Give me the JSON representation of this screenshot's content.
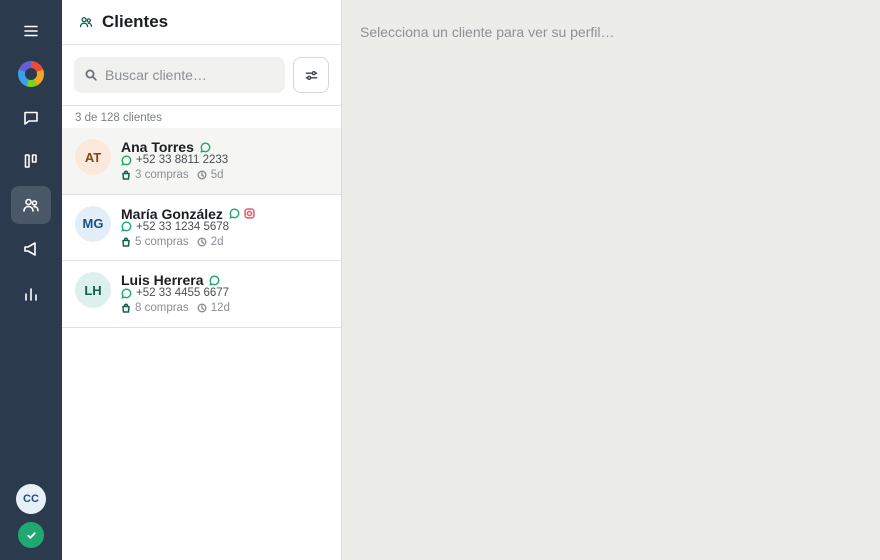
{
  "sidebar": {
    "items": [
      {
        "key": "menu",
        "icon": "menu-icon"
      },
      {
        "key": "logo",
        "icon": "logo-icon"
      },
      {
        "key": "chats",
        "icon": "chat-icon"
      },
      {
        "key": "board",
        "icon": "kanban-icon"
      },
      {
        "key": "clients",
        "icon": "users-icon",
        "active": true
      },
      {
        "key": "campaigns",
        "icon": "megaphone-icon"
      },
      {
        "key": "reports",
        "icon": "bar-chart-icon"
      }
    ],
    "user_initials": "CC",
    "status": "online"
  },
  "panel": {
    "title": "Clientes",
    "title_icon": "users-icon",
    "search_placeholder": "Buscar cliente…",
    "count_text": "3 de 128 clientes"
  },
  "clients": [
    {
      "initials": "AT",
      "name": "Ana Torres",
      "phone": "+52 33 8811 2233",
      "purchases": "3 compras",
      "last": "5d",
      "channels": [
        "whatsapp"
      ],
      "avatar_bg": "#fbeadb",
      "avatar_fg": "#7a4a1c",
      "selected": true
    },
    {
      "initials": "MG",
      "name": "María González",
      "phone": "+52 33 1234 5678",
      "purchases": "5 compras",
      "last": "2d",
      "channels": [
        "whatsapp",
        "instagram"
      ],
      "avatar_bg": "#e3eef8",
      "avatar_fg": "#1e4f86",
      "selected": false
    },
    {
      "initials": "LH",
      "name": "Luis Herrera",
      "phone": "+52 33 4455 6677",
      "purchases": "8 compras",
      "last": "12d",
      "channels": [
        "whatsapp"
      ],
      "avatar_bg": "#ddf0ec",
      "avatar_fg": "#12614f",
      "selected": false
    }
  ],
  "detail": {
    "empty_text": "Selecciona un cliente para ver su perfil…"
  },
  "colors": {
    "sidebar_bg": "#2b3a4c",
    "accent": "#12614f",
    "whatsapp": "#1fa971",
    "instagram": "#e0667a"
  }
}
